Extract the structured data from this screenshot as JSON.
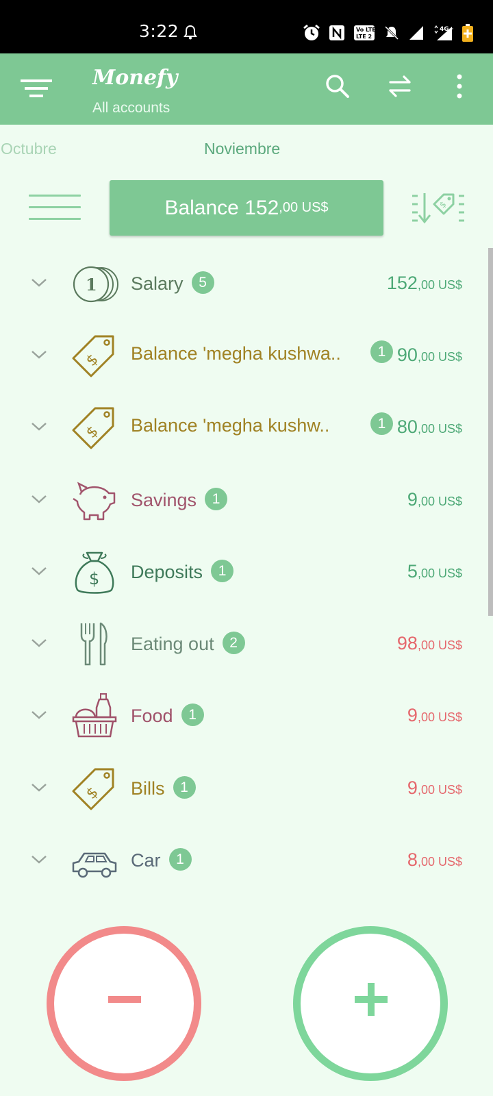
{
  "status_bar": {
    "time": "3:22"
  },
  "app_bar": {
    "title": "Monefy",
    "subtitle": "All accounts"
  },
  "months": {
    "previous": "Octubre",
    "current": "Noviembre"
  },
  "balance": {
    "label": "Balance",
    "integer": "152",
    "cents": ",00",
    "currency": "US$"
  },
  "categories": [
    {
      "name": "Salary",
      "count": "5",
      "amount": "152",
      "cents": ",00",
      "currency": "US$",
      "type": "income",
      "icon": "coins-icon",
      "color": "#5b7a5e"
    },
    {
      "name": "Balance 'megha kushwa..",
      "count": "1",
      "amount": "90",
      "cents": ",00",
      "currency": "US$",
      "type": "income",
      "icon": "price-tag-icon",
      "color": "#a08224"
    },
    {
      "name": "Balance 'megha kushw..",
      "count": "1",
      "amount": "80",
      "cents": ",00",
      "currency": "US$",
      "type": "income",
      "icon": "price-tag-icon",
      "color": "#a08224"
    },
    {
      "name": "Savings",
      "count": "1",
      "amount": "9",
      "cents": ",00",
      "currency": "US$",
      "type": "income",
      "icon": "piggy-bank-icon",
      "color": "#a1546c"
    },
    {
      "name": "Deposits",
      "count": "1",
      "amount": "5",
      "cents": ",00",
      "currency": "US$",
      "type": "income",
      "icon": "money-bag-icon",
      "color": "#3f7a5a"
    },
    {
      "name": "Eating out",
      "count": "2",
      "amount": "98",
      "cents": ",00",
      "currency": "US$",
      "type": "expense",
      "icon": "fork-knife-icon",
      "color": "#6c8a78"
    },
    {
      "name": "Food",
      "count": "1",
      "amount": "9",
      "cents": ",00",
      "currency": "US$",
      "type": "expense",
      "icon": "shopping-basket-icon",
      "color": "#a0526a"
    },
    {
      "name": "Bills",
      "count": "1",
      "amount": "9",
      "cents": ",00",
      "currency": "US$",
      "type": "expense",
      "icon": "price-tag-icon",
      "color": "#a08224"
    },
    {
      "name": "Car",
      "count": "1",
      "amount": "8",
      "cents": ",00",
      "currency": "US$",
      "type": "expense",
      "icon": "car-icon",
      "color": "#5a6a78"
    }
  ],
  "colors": {
    "primary": "#7ec894",
    "income": "#4ea977",
    "expense": "#e5686d",
    "minus_button": "#f28a8a",
    "plus_button": "#7ed69b",
    "background": "#effcf1"
  }
}
